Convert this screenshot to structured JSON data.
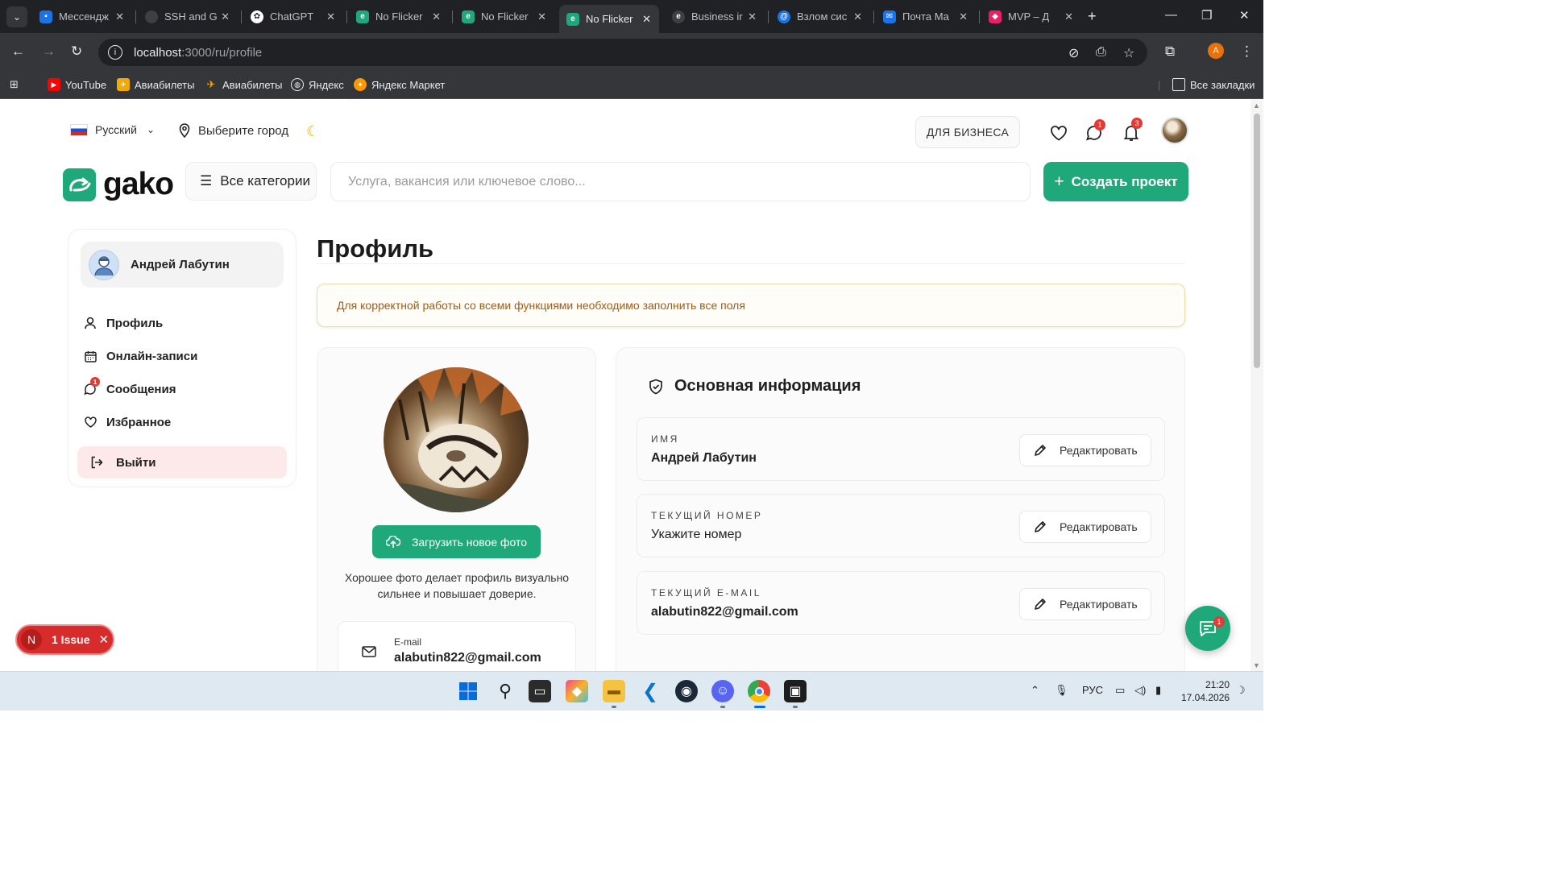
{
  "browser": {
    "tabs": [
      {
        "title": "Мессендж",
        "favicon_color": "#1a73e8",
        "active": false
      },
      {
        "title": "SSH and G",
        "favicon_color": "#3c4043",
        "active": false
      },
      {
        "title": "ChatGPT",
        "favicon_color": "#ffffff",
        "active": false
      },
      {
        "title": "No Flicker",
        "favicon_color": "#1fa87a",
        "active": false
      },
      {
        "title": "No Flicker",
        "favicon_color": "#1fa87a",
        "active": false
      },
      {
        "title": "No Flicker",
        "favicon_color": "#1fa87a",
        "active": true
      },
      {
        "title": "Business ir",
        "favicon_color": "#3c4043",
        "active": false
      },
      {
        "title": "Взлом сис",
        "favicon_color": "#1a73e8",
        "active": false
      },
      {
        "title": "Почта Ма",
        "favicon_color": "#1a73e8",
        "active": false
      },
      {
        "title": "MVP – Д",
        "favicon_color": "#e91e63",
        "active": false
      }
    ],
    "url_host": "localhost",
    "url_path": ":3000/ru/profile",
    "profile_initial": "A",
    "bookmarks": [
      {
        "label": "YouTube",
        "icon": "youtube-icon",
        "color": "#ff0000"
      },
      {
        "label": "Авиабилеты",
        "icon": "aviasales-icon",
        "color": "#f2a900"
      },
      {
        "label": "Авиабилеты",
        "icon": "plane-icon",
        "color": "#f2a900"
      },
      {
        "label": "Яндекс",
        "icon": "globe-icon",
        "color": "#ffffff"
      },
      {
        "label": "Яндекс Маркет",
        "icon": "yandex-market-icon",
        "color": "#ff9800"
      }
    ],
    "all_bookmarks_label": "Все закладки"
  },
  "header": {
    "language": "Русский",
    "city": "Выберите город",
    "business_button": "ДЛЯ БИЗНЕСА",
    "messages_badge": "1",
    "notifications_badge": "3",
    "logo_text": "gako",
    "categories_label": "Все категории",
    "search_placeholder": "Услуга, вакансия или ключевое слово...",
    "create_button": "Создать проект",
    "accent_color": "#1fa87a"
  },
  "sidebar": {
    "user_name": "Андрей Лабутин",
    "items": [
      {
        "label": "Профиль",
        "icon": "user-icon"
      },
      {
        "label": "Онлайн-записи",
        "icon": "calendar-icon"
      },
      {
        "label": "Сообщения",
        "icon": "chat-icon",
        "badge": "1"
      },
      {
        "label": "Избранное",
        "icon": "heart-icon"
      }
    ],
    "logout_label": "Выйти"
  },
  "main": {
    "title": "Профиль",
    "alert": "Для корректной работы со всеми функциями необходимо заполнить все поля",
    "photo": {
      "upload_label": "Загрузить новое фото",
      "hint": "Хорошее фото делает профиль визуально сильнее и повышает доверие.",
      "email_label": "E-mail",
      "email_value": "alabutin822@gmail.com"
    },
    "info": {
      "title": "Основная информация",
      "fields": [
        {
          "label": "ИМЯ",
          "value": "Андрей Лабутин",
          "edit_label": "Редактировать"
        },
        {
          "label": "ТЕКУЩИЙ НОМЕР",
          "value": "Укажите номер",
          "edit_label": "Редактировать"
        },
        {
          "label": "ТЕКУЩИЙ E-MAIL",
          "value": "alabutin822@gmail.com",
          "edit_label": "Редактировать"
        }
      ]
    }
  },
  "overlay": {
    "issue_initial": "N",
    "issue_label": "1 Issue",
    "chat_badge": "1"
  },
  "taskbar": {
    "language": "РУС",
    "time": "21:20",
    "date": "17.04.2026"
  }
}
